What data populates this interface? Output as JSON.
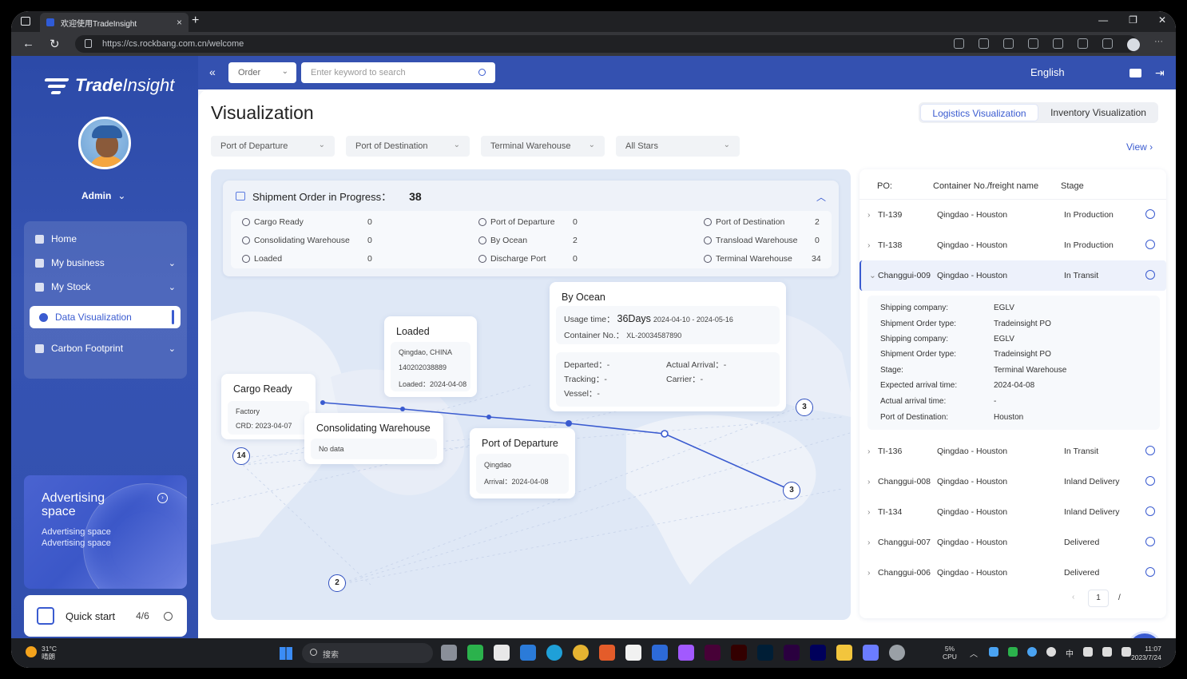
{
  "browser": {
    "tab_title": "欢迎使用TradeInsight",
    "url_host": "https://cs.rockbang.com.cn",
    "url_path": "/welcome"
  },
  "brand": {
    "name_bold": "Trade",
    "name_thin": "Insight"
  },
  "user": {
    "name": "Admin"
  },
  "sidebar": {
    "items": [
      {
        "label": "Home",
        "icon": "home-icon"
      },
      {
        "label": "My business",
        "icon": "business-icon"
      },
      {
        "label": "My Stock",
        "icon": "stock-icon"
      },
      {
        "label": "Data Visualization",
        "icon": "chart-icon"
      },
      {
        "label": "Carbon Footprint",
        "icon": "cloud-icon"
      }
    ],
    "ad": {
      "title": "Advertising space",
      "text": "Advertising space Advertising space"
    },
    "quick_start": {
      "label": "Quick start",
      "progress": "4/6"
    }
  },
  "topbar": {
    "order_select": "Order",
    "search_placeholder": "Enter keyword to search",
    "language": "English"
  },
  "page": {
    "title": "Visualization",
    "seg_logistics": "Logistics Visualization",
    "seg_inventory": "Inventory Visualization",
    "view": "View",
    "filters": [
      "Port of Departure",
      "Port of Destination",
      "Terminal Warehouse",
      "All Stars"
    ]
  },
  "summary": {
    "title": "Shipment Order in Progress：",
    "total": "38",
    "items": [
      {
        "label": "Cargo Ready",
        "value": "0"
      },
      {
        "label": "Consolidating Warehouse",
        "value": "0"
      },
      {
        "label": "Loaded",
        "value": "0"
      },
      {
        "label": "Port of Departure",
        "value": "0"
      },
      {
        "label": "By Ocean",
        "value": "2"
      },
      {
        "label": "Discharge Port",
        "value": "0"
      },
      {
        "label": "Port of Destination",
        "value": "2"
      },
      {
        "label": "Transload Warehouse",
        "value": "0"
      },
      {
        "label": "Terminal Warehouse",
        "value": "34"
      }
    ]
  },
  "cards": {
    "cargo_ready": {
      "title": "Cargo Ready",
      "line1": "Factory",
      "line2": "CRD: 2023-04-07"
    },
    "consolidating": {
      "title": "Consolidating Warehouse",
      "line1": "No data"
    },
    "loaded": {
      "title": "Loaded",
      "line1": "Qingdao, CHINA",
      "line2": "140202038889",
      "line3": "Loaded：2024-04-08"
    },
    "departure": {
      "title": "Port of Departure",
      "line1": "Qingdao",
      "line2": "Arrival：2024-04-08"
    },
    "ocean": {
      "title": "By Ocean",
      "usage_label": "Usage time：",
      "usage_value": "36Days",
      "usage_range": "2024-04-10 - 2024-05-16",
      "container_label": "Container No.：",
      "container_value": "XL-20034587890",
      "departed": "Departed：-",
      "tracking": "Tracking：-",
      "vessel": "Vessel：-",
      "actual_arrival": "Actual Arrival：-",
      "carrier": "Carrier：-"
    }
  },
  "pins": [
    "14",
    "2",
    "3",
    "3"
  ],
  "table": {
    "headers": [
      "PO:",
      "Container No./freight name",
      "Stage"
    ],
    "rows": [
      {
        "po": "TI-139",
        "route": "Qingdao - Houston",
        "stage": "In Production"
      },
      {
        "po": "TI-138",
        "route": "Qingdao - Houston",
        "stage": "In Production"
      },
      {
        "po": "Changgui-009",
        "route": "Qingdao - Houston",
        "stage": "In Transit"
      },
      {
        "po": "TI-136",
        "route": "Qingdao - Houston",
        "stage": "In Transit"
      },
      {
        "po": "Changgui-008",
        "route": "Qingdao - Houston",
        "stage": "Inland Delivery"
      },
      {
        "po": "TI-134",
        "route": "Qingdao - Houston",
        "stage": "Inland Delivery"
      },
      {
        "po": "Changgui-007",
        "route": "Qingdao - Houston",
        "stage": "Delivered"
      },
      {
        "po": "Changgui-006",
        "route": "Qingdao - Houston",
        "stage": "Delivered"
      }
    ],
    "detail": [
      {
        "k": "Shipping company:",
        "v": "EGLV"
      },
      {
        "k": "Shipment Order type:",
        "v": "Tradeinsight PO"
      },
      {
        "k": "Shipping company:",
        "v": "EGLV"
      },
      {
        "k": "Shipment Order type:",
        "v": "Tradeinsight PO"
      },
      {
        "k": "Stage:",
        "v": "Terminal Warehouse"
      },
      {
        "k": "Expected arrival time:",
        "v": "2024-04-08"
      },
      {
        "k": "Actual arrival time:",
        "v": "-"
      },
      {
        "k": "Port of Destination:",
        "v": "Houston"
      }
    ],
    "page": "1",
    "page_sep": "/"
  },
  "taskbar": {
    "temp": "31°C",
    "weather": "晴朗",
    "search": "搜索",
    "cpu_pct": "5%",
    "cpu": "CPU",
    "ime": "中",
    "time": "11:07",
    "date": "2023/7/24"
  },
  "colors": {
    "accent": "#3a5bd0",
    "sidebar": "#3451b0"
  }
}
